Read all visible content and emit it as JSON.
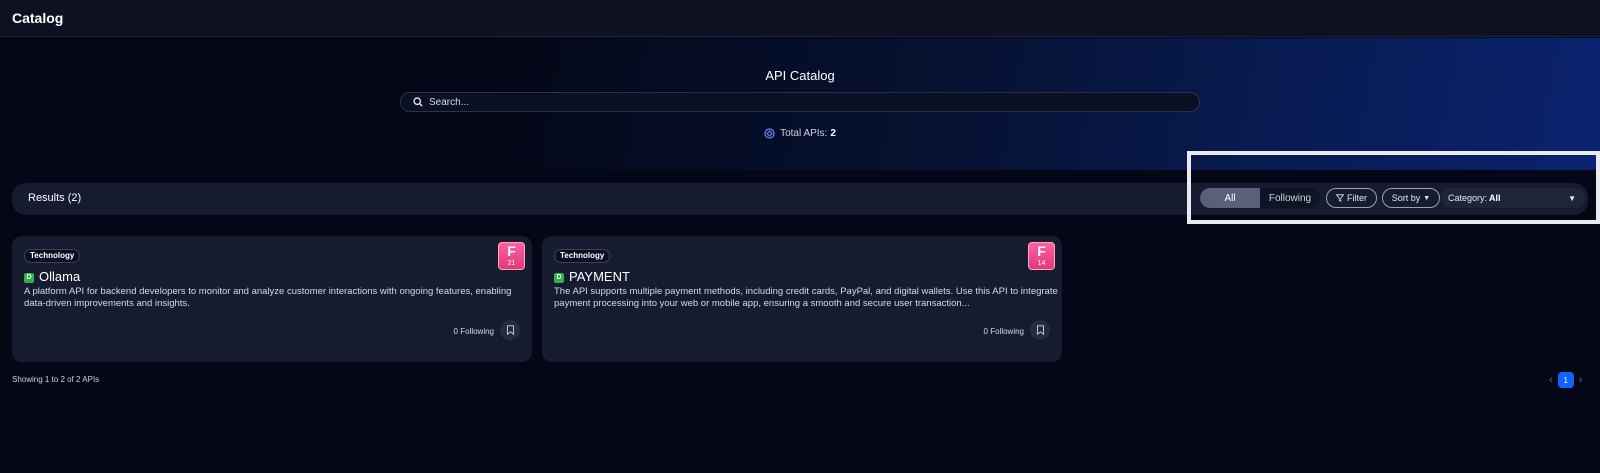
{
  "header": {
    "title": "Catalog"
  },
  "hero": {
    "title": "API Catalog",
    "search_placeholder": "Search...",
    "total_label": "Total APIs:",
    "total_value": "2"
  },
  "results": {
    "label": "Results (2)",
    "toggle": {
      "all": "All",
      "following": "Following"
    },
    "filter_label": "Filter",
    "sort_label": "Sort by",
    "category_label": "Category:",
    "category_value": "All"
  },
  "cards": [
    {
      "tag": "Technology",
      "status": "D",
      "name": "Ollama",
      "description": "A platform API for backend developers to monitor and analyze customer interactions with ongoing features, enabling data-driven improvements and insights.",
      "grade": "F",
      "score": "21",
      "following": "0 Following"
    },
    {
      "tag": "Technology",
      "status": "D",
      "name": "PAYMENT",
      "description": "The API supports multiple payment methods, including credit cards, PayPal, and digital wallets. Use this API to integrate payment processing into your web or mobile app, ensuring a smooth and secure user transaction...",
      "grade": "F",
      "score": "14",
      "following": "0 Following"
    }
  ],
  "footer": {
    "showing": "Showing 1 to 2 of 2 APIs",
    "page": "1"
  },
  "colors": {
    "background": "#040716",
    "accent": "#1461ff",
    "grade": "#ff5fa0",
    "status": "#2fb344"
  }
}
